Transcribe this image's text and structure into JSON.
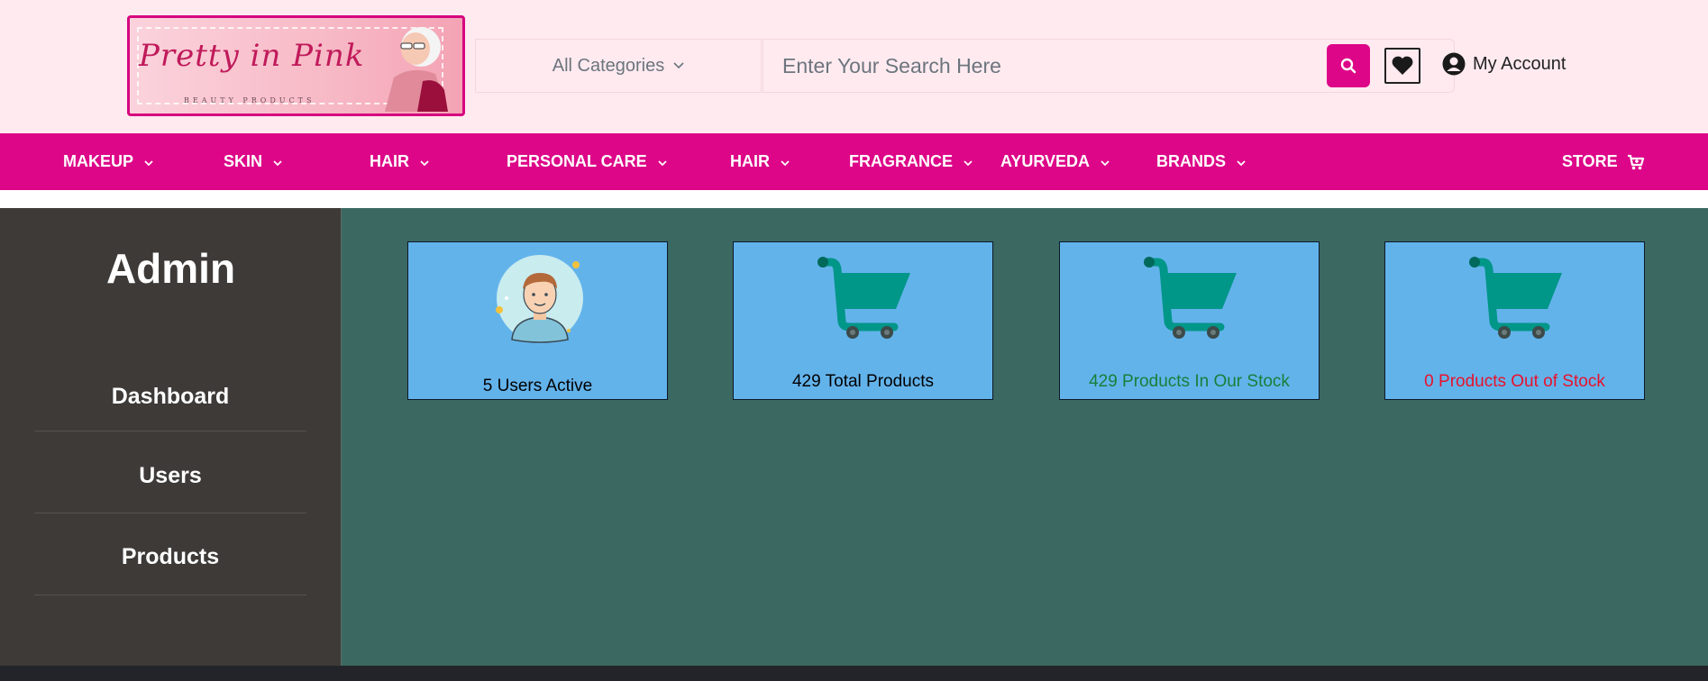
{
  "header": {
    "logo": {
      "script_text": "Pretty in Pink",
      "subtitle": "BEAUTY PRODUCTS"
    },
    "category_select": {
      "label": "All Categories",
      "icon": "chevron-down-icon"
    },
    "search": {
      "placeholder": "Enter Your Search Here",
      "button_icon": "search-icon"
    },
    "wishlist_icon": "heart-icon",
    "account": {
      "label": "My Account",
      "icon": "user-circle-icon"
    }
  },
  "nav": {
    "items": [
      {
        "label": "MAKEUP"
      },
      {
        "label": "SKIN"
      },
      {
        "label": "HAIR"
      },
      {
        "label": "PERSONAL CARE"
      },
      {
        "label": "HAIR"
      },
      {
        "label": "FRAGRANCE"
      },
      {
        "label": "AYURVEDA"
      },
      {
        "label": "BRANDS"
      }
    ],
    "store": {
      "label": "STORE",
      "icon": "cart-icon"
    }
  },
  "sidebar": {
    "title": "Admin",
    "links": [
      {
        "label": "Dashboard"
      },
      {
        "label": "Users"
      },
      {
        "label": "Products"
      }
    ]
  },
  "cards": [
    {
      "label": "5 Users Active",
      "icon": "user-avatar-icon",
      "color": "#1a1a1a"
    },
    {
      "label": "429 Total Products",
      "icon": "shopping-cart-icon",
      "color": "#1a1a1a"
    },
    {
      "label": "429 Products In Our Stock",
      "icon": "shopping-cart-icon",
      "color": "#16803a"
    },
    {
      "label": "0 Products Out of Stock",
      "icon": "shopping-cart-icon",
      "color": "#e8122c"
    }
  ],
  "colors": {
    "brand_pink": "#dd0688",
    "header_bg": "#ffeaf0",
    "sidebar_bg": "#3d3a38",
    "main_bg": "#3b6861",
    "card_bg": "#63b3eb",
    "cart_color": "#009688"
  }
}
